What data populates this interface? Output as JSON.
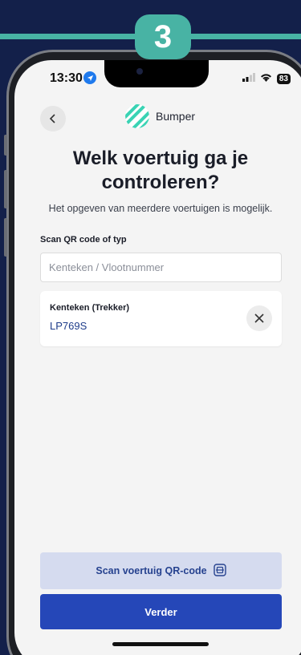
{
  "step": {
    "number": "3"
  },
  "status_bar": {
    "time": "13:30",
    "battery": "83"
  },
  "header": {
    "back_icon": "chevron-left-icon",
    "brand_name": "Bumper"
  },
  "main": {
    "title": "Welk voertuig ga je controleren?",
    "subtitle": "Het opgeven van meerdere voertuigen is mogelijk.",
    "scan_label": "Scan QR code of typ",
    "search": {
      "placeholder": "Kenteken / Vlootnummer",
      "value": ""
    },
    "vehicles": [
      {
        "type": "Kenteken (Trekker)",
        "plate": "LP769S",
        "remove_icon": "close-icon"
      }
    ]
  },
  "actions": {
    "scan_qr_label": "Scan voertuig QR-code",
    "next_label": "Verder"
  },
  "colors": {
    "accent": "#48b3a4",
    "primary": "#2547b8",
    "secondary_button": "#d5dbef",
    "background": "#13204a"
  }
}
